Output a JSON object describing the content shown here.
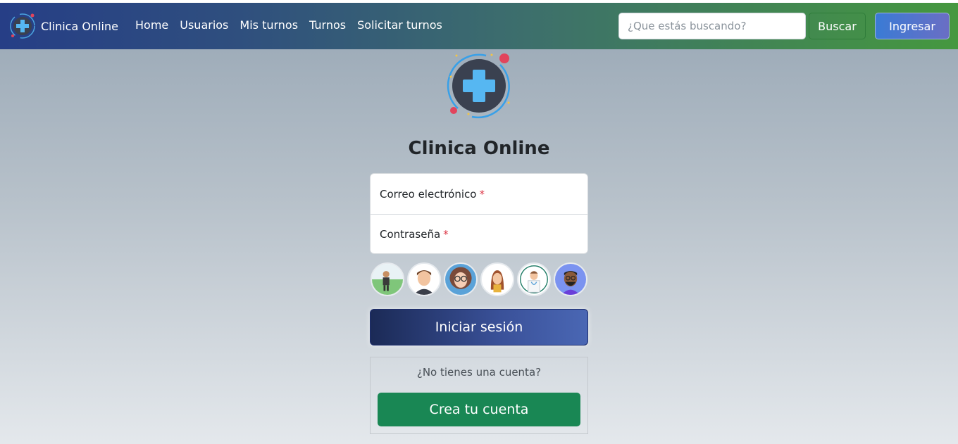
{
  "navbar": {
    "brand": "Clinica Online",
    "links": [
      "Home",
      "Usuarios",
      "Mis turnos",
      "Turnos",
      "Solicitar turnos"
    ],
    "search_placeholder": "¿Que estás buscando?",
    "search_button": "Buscar",
    "login_button": "Ingresar"
  },
  "main": {
    "title": "Clinica Online",
    "email_label": "Correo electrónico",
    "password_label": "Contraseña",
    "required_mark": "*",
    "login_button": "Iniciar sesión",
    "no_account": "¿No tienes una cuenta?",
    "create_button": "Crea tu cuenta"
  },
  "colors": {
    "navbar_start": "#263e86",
    "navbar_end": "#45983f",
    "create_button": "#198754",
    "login_button": "#3a5199",
    "required": "#dc3545"
  },
  "icons": [
    "clinic-logo-icon",
    "quick-login-avatars"
  ]
}
